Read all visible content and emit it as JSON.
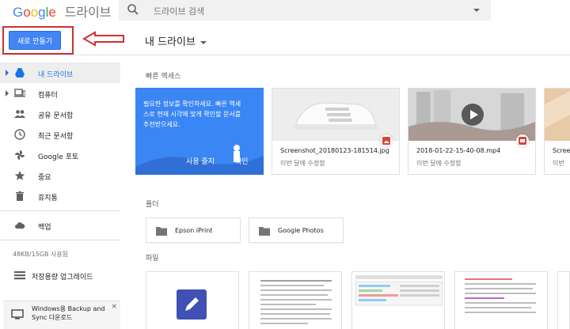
{
  "header": {
    "logo_letters": [
      "G",
      "o",
      "o",
      "g",
      "l",
      "e"
    ],
    "logo_colors": [
      "#4285f4",
      "#ea4335",
      "#fbbc05",
      "#4285f4",
      "#34a853",
      "#ea4335"
    ],
    "product": "드라이브",
    "search_placeholder": "드라이브 검색"
  },
  "toolbar": {
    "new_label": "새로 만들기",
    "breadcrumb": "내 드라이브"
  },
  "sidebar": {
    "items": [
      {
        "label": "내 드라이브",
        "icon": "drive-icon"
      },
      {
        "label": "컴퓨터",
        "icon": "computer-icon"
      },
      {
        "label": "공유 문서함",
        "icon": "people-icon"
      },
      {
        "label": "최근 문서함",
        "icon": "clock-icon"
      },
      {
        "label": "Google 포토",
        "icon": "pinwheel-icon"
      },
      {
        "label": "중요",
        "icon": "star-icon"
      },
      {
        "label": "휴지통",
        "icon": "trash-icon"
      }
    ],
    "backup": {
      "label": "백업",
      "icon": "cloud-icon"
    },
    "storage_text": "48KB/15GB 사용됨",
    "upgrade_label": "저장용량 업그레이드",
    "promo_text": "Windows용 Backup and Sync 다운로드",
    "close_glyph": "×"
  },
  "main": {
    "quick_access_title": "빠른 액세스",
    "promo": {
      "text": "필요한 정보를 확인하세요. 빠른 액세스로 현재 시각에 맞게 확인할 문서를 추천받으세요.",
      "dismiss": "사용 중지",
      "confirm": "확인"
    },
    "quick_files": [
      {
        "name": "Screenshot_20180123-181514.jpg",
        "meta": "이번 달에 수정함",
        "type": "image"
      },
      {
        "name": "2018-01-22-15-40-08.mp4",
        "meta": "이번 달에 수정함",
        "type": "video"
      },
      {
        "name": "Scree",
        "meta": "이번",
        "type": "image"
      }
    ],
    "folders_title": "폴더",
    "folders": [
      {
        "name": "Epson iPrint"
      },
      {
        "name": "Google Photos"
      }
    ],
    "files_title": "파일"
  },
  "colors": {
    "accent": "#4285f4",
    "promo_bg": "#3b86f5",
    "highlight": "#d32f2f"
  }
}
